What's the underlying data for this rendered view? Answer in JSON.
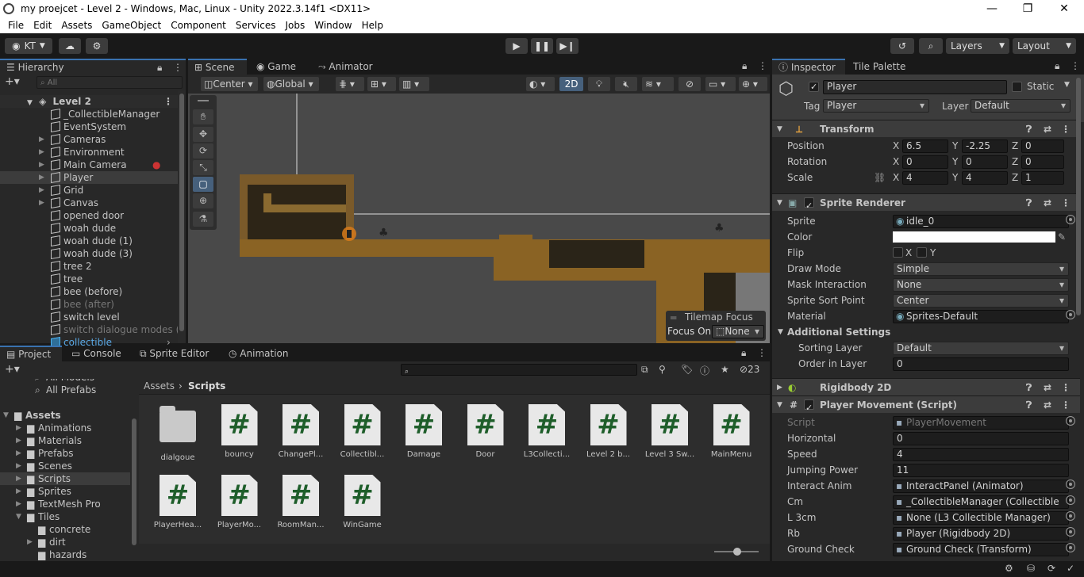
{
  "window": {
    "title": "my proejcet - Level 2 - Windows, Mac, Linux - Unity 2022.3.14f1 <DX11>",
    "minimize": "—",
    "maximize": "❐",
    "close": "✕"
  },
  "menu": [
    "File",
    "Edit",
    "Assets",
    "GameObject",
    "Component",
    "Services",
    "Jobs",
    "Window",
    "Help"
  ],
  "toolbar": {
    "account": "KT",
    "layers": "Layers",
    "layout": "Layout"
  },
  "hierarchy": {
    "tab": "Hierarchy",
    "search_placeholder": "All",
    "scene": "Level 2",
    "items": [
      {
        "label": "_CollectibleManager",
        "expand": false,
        "dim": false
      },
      {
        "label": "EventSystem",
        "expand": false,
        "dim": false
      },
      {
        "label": "Cameras",
        "expand": true,
        "dim": false
      },
      {
        "label": "Environment",
        "expand": true,
        "dim": false
      },
      {
        "label": "Main Camera",
        "expand": true,
        "dim": false
      },
      {
        "label": "Player",
        "expand": true,
        "dim": false
      },
      {
        "label": "Grid",
        "expand": true,
        "dim": false
      },
      {
        "label": "Canvas",
        "expand": true,
        "dim": false
      },
      {
        "label": "opened door",
        "expand": false,
        "dim": false
      },
      {
        "label": "woah dude",
        "expand": false,
        "dim": false
      },
      {
        "label": "woah dude (1)",
        "expand": false,
        "dim": false
      },
      {
        "label": "woah dude (3)",
        "expand": false,
        "dim": false
      },
      {
        "label": "tree 2",
        "expand": false,
        "dim": false
      },
      {
        "label": "tree",
        "expand": false,
        "dim": false
      },
      {
        "label": "bee (before)",
        "expand": false,
        "dim": false
      },
      {
        "label": "bee (after)",
        "expand": false,
        "dim": true
      },
      {
        "label": "switch level",
        "expand": false,
        "dim": false
      },
      {
        "label": "switch dialogue modes (a",
        "expand": false,
        "dim": true
      },
      {
        "label": "collectible",
        "expand": false,
        "dim": false
      }
    ]
  },
  "scene_view": {
    "tabs": [
      "Scene",
      "Game",
      "Animator"
    ],
    "pivot": "Center",
    "space": "Global",
    "mode_2d": "2D",
    "tilemap_focus_title": "Tilemap Focus",
    "focus_on_label": "Focus On",
    "focus_on_value": "None"
  },
  "project": {
    "tabs": [
      "Project",
      "Console",
      "Sprite Editor",
      "Animation"
    ],
    "hidden_count": "23",
    "breadcrumb": [
      "Assets",
      "Scripts"
    ],
    "tree": [
      {
        "label": "All Models"
      },
      {
        "label": "All Prefabs"
      },
      {
        "label": "Assets"
      },
      {
        "label": "Animations"
      },
      {
        "label": "Materials"
      },
      {
        "label": "Prefabs"
      },
      {
        "label": "Scenes"
      },
      {
        "label": "Scripts"
      },
      {
        "label": "Sprites"
      },
      {
        "label": "TextMesh Pro"
      },
      {
        "label": "Tiles"
      },
      {
        "label": "concrete"
      },
      {
        "label": "dirt"
      },
      {
        "label": "hazards"
      }
    ],
    "files": [
      "dialgoue",
      "bouncy",
      "ChangePl...",
      "Collectibl...",
      "Damage",
      "Door",
      "L3Collecti...",
      "Level 2 b...",
      "Level 3 Sw...",
      "MainMenu",
      "PlayerHea...",
      "PlayerMo...",
      "RoomMan...",
      "WinGame"
    ]
  },
  "inspector": {
    "tabs": [
      "Inspector",
      "Tile Palette"
    ],
    "object_name": "Player",
    "static_label": "Static",
    "tag_label": "Tag",
    "tag": "Player",
    "layer_label": "Layer",
    "layer": "Default",
    "transform": {
      "title": "Transform",
      "position_label": "Position",
      "position": [
        "6.5",
        "-2.25",
        "0"
      ],
      "rotation_label": "Rotation",
      "rotation": [
        "0",
        "0",
        "0"
      ],
      "scale_label": "Scale",
      "scale": [
        "4",
        "4",
        "1"
      ]
    },
    "sprite_renderer": {
      "title": "Sprite Renderer",
      "sprite_label": "Sprite",
      "sprite": "idle_0",
      "color_label": "Color",
      "color": "#ffffff",
      "flip_label": "Flip",
      "flip_x": "X",
      "flip_y": "Y",
      "draw_mode_label": "Draw Mode",
      "draw_mode": "Simple",
      "mask_label": "Mask Interaction",
      "mask": "None",
      "sort_point_label": "Sprite Sort Point",
      "sort_point": "Center",
      "material_label": "Material",
      "material": "Sprites-Default",
      "additional": "Additional Settings",
      "sorting_layer_label": "Sorting Layer",
      "sorting_layer": "Default",
      "order_label": "Order in Layer",
      "order": "0"
    },
    "rigidbody": {
      "title": "Rigidbody 2D"
    },
    "player_movement": {
      "title": "Player Movement (Script)",
      "fields": [
        {
          "label": "Script",
          "value": "PlayerMovement",
          "dim": true,
          "ref": true
        },
        {
          "label": "Horizontal",
          "value": "0",
          "dim": false,
          "ref": false
        },
        {
          "label": "Speed",
          "value": "4",
          "dim": false,
          "ref": false
        },
        {
          "label": "Jumping Power",
          "value": "11",
          "dim": false,
          "ref": false
        },
        {
          "label": "Interact Anim",
          "value": "InteractPanel (Animator)",
          "dim": false,
          "ref": true
        },
        {
          "label": "Cm",
          "value": "_CollectibleManager (Collectible",
          "dim": false,
          "ref": true
        },
        {
          "label": "L 3cm",
          "value": "None (L3 Collectible Manager)",
          "dim": false,
          "ref": true
        },
        {
          "label": "Rb",
          "value": "Player (Rigidbody 2D)",
          "dim": false,
          "ref": true
        },
        {
          "label": "Ground Check",
          "value": "Ground Check (Transform)",
          "dim": false,
          "ref": true
        }
      ]
    }
  }
}
